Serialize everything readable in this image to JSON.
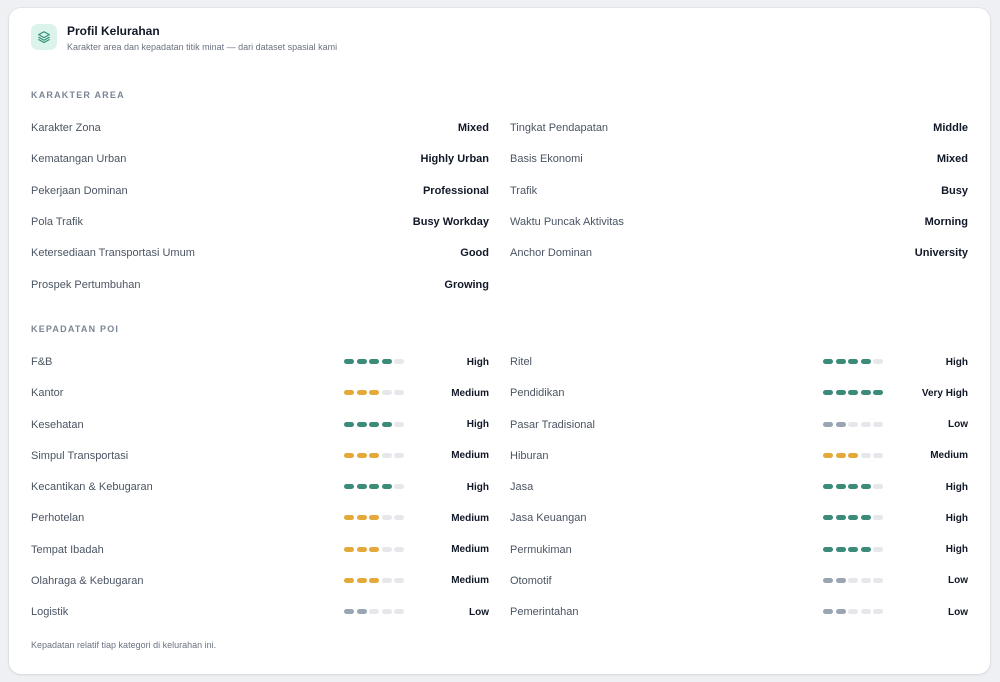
{
  "header": {
    "title": "Profil Kelurahan",
    "subtitle": "Karakter area dan kepadatan titik minat — dari dataset spasial kami",
    "icon": "layers-icon"
  },
  "karakter": {
    "section_title": "KARAKTER AREA",
    "left": [
      {
        "label": "Karakter Zona",
        "value": "Mixed"
      },
      {
        "label": "Kematangan Urban",
        "value": "Highly Urban"
      },
      {
        "label": "Pekerjaan Dominan",
        "value": "Professional"
      },
      {
        "label": "Pola Trafik",
        "value": "Busy Workday"
      },
      {
        "label": "Ketersediaan Transportasi Umum",
        "value": "Good"
      },
      {
        "label": "Prospek Pertumbuhan",
        "value": "Growing"
      }
    ],
    "right": [
      {
        "label": "Tingkat Pendapatan",
        "value": "Middle"
      },
      {
        "label": "Basis Ekonomi",
        "value": "Mixed"
      },
      {
        "label": "Trafik",
        "value": "Busy"
      },
      {
        "label": "Waktu Puncak Aktivitas",
        "value": "Morning"
      },
      {
        "label": "Anchor Dominan",
        "value": "University"
      }
    ]
  },
  "kepadatan": {
    "section_title": "KEPADATAN POI",
    "left": [
      {
        "label": "F&B",
        "value": "High",
        "level": 4
      },
      {
        "label": "Kantor",
        "value": "Medium",
        "level": 3
      },
      {
        "label": "Kesehatan",
        "value": "High",
        "level": 4
      },
      {
        "label": "Simpul Transportasi",
        "value": "Medium",
        "level": 3
      },
      {
        "label": "Kecantikan & Kebugaran",
        "value": "High",
        "level": 4
      },
      {
        "label": "Perhotelan",
        "value": "Medium",
        "level": 3
      },
      {
        "label": "Tempat Ibadah",
        "value": "Medium",
        "level": 3
      },
      {
        "label": "Olahraga & Kebugaran",
        "value": "Medium",
        "level": 3
      },
      {
        "label": "Logistik",
        "value": "Low",
        "level": 2
      }
    ],
    "right": [
      {
        "label": "Ritel",
        "value": "High",
        "level": 4
      },
      {
        "label": "Pendidikan",
        "value": "Very High",
        "level": 5
      },
      {
        "label": "Pasar Tradisional",
        "value": "Low",
        "level": 2
      },
      {
        "label": "Hiburan",
        "value": "Medium",
        "level": 3
      },
      {
        "label": "Jasa",
        "value": "High",
        "level": 4
      },
      {
        "label": "Jasa Keuangan",
        "value": "High",
        "level": 4
      },
      {
        "label": "Permukiman",
        "value": "High",
        "level": 4
      },
      {
        "label": "Otomotif",
        "value": "Low",
        "level": 2
      },
      {
        "label": "Pemerintahan",
        "value": "Low",
        "level": 2
      }
    ],
    "max_level": 5
  },
  "colors": {
    "high": "#3b8a7a",
    "medium": "#e3a93b",
    "low": "#9aa5b4",
    "empty": "#e5e7eb",
    "accent_bg": "#dcf3ec"
  },
  "footer": "Kepadatan relatif tiap kategori di kelurahan ini."
}
